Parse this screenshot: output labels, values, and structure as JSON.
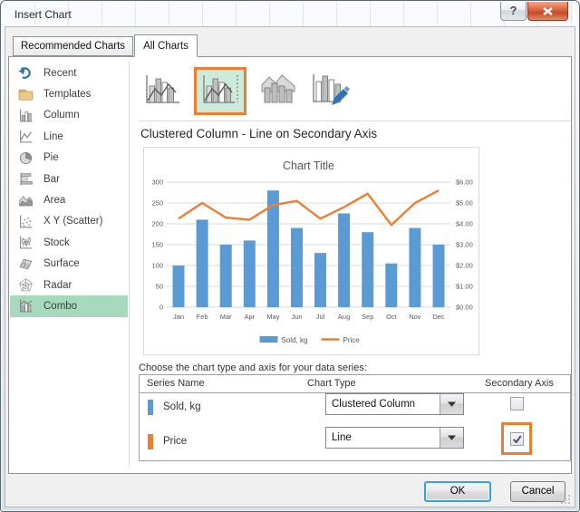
{
  "window": {
    "title": "Insert Chart",
    "help_glyph": "?"
  },
  "tabs": [
    {
      "key": "recommended-charts",
      "label": "Recommended Charts",
      "active": false
    },
    {
      "key": "all-charts",
      "label": "All Charts",
      "active": true
    }
  ],
  "sidebar": {
    "items": [
      {
        "key": "recent",
        "label": "Recent",
        "selected": false
      },
      {
        "key": "templates",
        "label": "Templates",
        "selected": false
      },
      {
        "key": "column",
        "label": "Column",
        "selected": false
      },
      {
        "key": "line",
        "label": "Line",
        "selected": false
      },
      {
        "key": "pie",
        "label": "Pie",
        "selected": false
      },
      {
        "key": "bar",
        "label": "Bar",
        "selected": false
      },
      {
        "key": "area",
        "label": "Area",
        "selected": false
      },
      {
        "key": "scatter",
        "label": "X Y (Scatter)",
        "selected": false
      },
      {
        "key": "stock",
        "label": "Stock",
        "selected": false
      },
      {
        "key": "surface",
        "label": "Surface",
        "selected": false
      },
      {
        "key": "radar",
        "label": "Radar",
        "selected": false
      },
      {
        "key": "combo",
        "label": "Combo",
        "selected": true
      }
    ]
  },
  "subtype_buttons": [
    {
      "key": "clustered-column-line",
      "selected": false
    },
    {
      "key": "clustered-column-line-secondary-axis",
      "selected": true
    },
    {
      "key": "stacked-area-clustered-column",
      "selected": false
    },
    {
      "key": "custom-combination",
      "selected": false
    }
  ],
  "preview": {
    "heading": "Clustered Column - Line on Secondary Axis"
  },
  "chart_data": {
    "type": "combo",
    "title": "Chart Title",
    "categories": [
      "Jan",
      "Feb",
      "Mar",
      "Apr",
      "May",
      "Jun",
      "Jul",
      "Aug",
      "Sep",
      "Oct",
      "Nov",
      "Dec"
    ],
    "series": [
      {
        "name": "Sold, kg",
        "chart_type": "bar",
        "axis": "primary",
        "color": "#5B9BD5",
        "values": [
          100,
          210,
          150,
          160,
          280,
          190,
          130,
          225,
          180,
          105,
          190,
          150
        ]
      },
      {
        "name": "Price",
        "chart_type": "line",
        "axis": "secondary",
        "color": "#ED7D31",
        "values": [
          4.25,
          5.0,
          4.3,
          4.2,
          4.9,
          5.1,
          4.25,
          4.8,
          5.45,
          3.95,
          5.0,
          5.6
        ]
      }
    ],
    "left_axis": {
      "min": 0,
      "max": 300,
      "step": 50,
      "tick_labels": [
        "0",
        "50",
        "100",
        "150",
        "200",
        "250",
        "300"
      ]
    },
    "right_axis": {
      "min": 0,
      "max": 6,
      "step": 1,
      "tick_labels": [
        "$0.00",
        "$1.00",
        "$2.00",
        "$3.00",
        "$4.00",
        "$5.00",
        "$6.00"
      ]
    },
    "legend_position": "bottom",
    "grid": true
  },
  "series_section": {
    "prompt": "Choose the chart type and axis for your data series:",
    "columns": [
      "Series Name",
      "Chart Type",
      "Secondary Axis"
    ],
    "rows": [
      {
        "name": "Sold, kg",
        "swatch_color": "#5B9BD5",
        "chart_type": "Clustered Column",
        "secondary_axis": false,
        "highlighted": false
      },
      {
        "name": "Price",
        "swatch_color": "#ED7D31",
        "chart_type": "Line",
        "secondary_axis": true,
        "highlighted": true
      }
    ]
  },
  "buttons": {
    "ok": "OK",
    "cancel": "Cancel"
  },
  "colors": {
    "accent_orange": "#ED7D31",
    "bar_blue": "#5B9BD5",
    "sidebar_selection_green": "#A7D9BD",
    "subtype_selected_bg": "#CDEBDA"
  }
}
